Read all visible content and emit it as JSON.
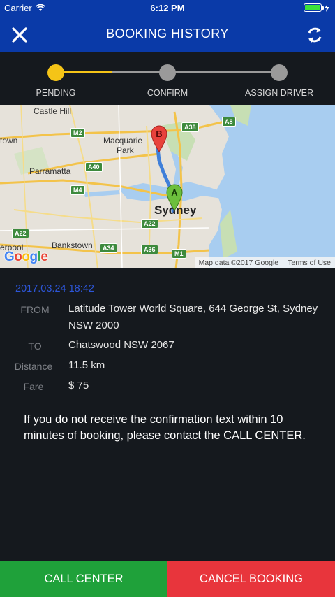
{
  "status_bar": {
    "carrier": "Carrier",
    "time": "6:12 PM",
    "battery_level": 1.0
  },
  "header": {
    "title": "BOOKING HISTORY",
    "close_icon": "close-icon",
    "refresh_icon": "refresh-icon"
  },
  "stepper": {
    "active_index": 0,
    "steps": [
      {
        "label": "PENDING"
      },
      {
        "label": "CONFIRM"
      },
      {
        "label": "ASSIGN DRIVER"
      }
    ],
    "colors": {
      "active": "#f5c417",
      "inactive": "#9a9a9a"
    }
  },
  "map": {
    "labels": {
      "castle_hill": "Castle Hill",
      "town": "town",
      "macquarie": "Macquarie",
      "park": "Park",
      "parramatta": "Parramatta",
      "sydney": "Sydney",
      "bankstown": "Bankstown",
      "erpool": "erpool"
    },
    "shields": {
      "m2": "M2",
      "a38": "A38",
      "a8": "A8",
      "a40": "A40",
      "m4": "M4",
      "a22a": "A22",
      "a22b": "A22",
      "a34": "A34",
      "a36": "A36",
      "m1": "M1"
    },
    "marker_a": "A",
    "marker_b": "B",
    "logo": "Google",
    "attribution": "Map data ©2017 Google",
    "terms": "Terms of Use"
  },
  "booking": {
    "datetime": "2017.03.24 18:42",
    "from_label": "FROM",
    "from_value": "Latitude Tower World Square, 644 George St, Sydney NSW 2000",
    "to_label": "TO",
    "to_value": "Chatswood NSW 2067",
    "distance_label": "Distance",
    "distance_value": "11.5 km",
    "fare_label": "Fare",
    "fare_value": "$ 75"
  },
  "notice": "If you do not receive the confirmation text within 10 minutes of booking, please contact the CALL CENTER.",
  "buttons": {
    "call_center": "CALL CENTER",
    "cancel_booking": "CANCEL BOOKING"
  },
  "colors": {
    "header": "#0a3aa8",
    "call_center": "#1fa13a",
    "cancel": "#e8353c",
    "date": "#2d56d8"
  }
}
